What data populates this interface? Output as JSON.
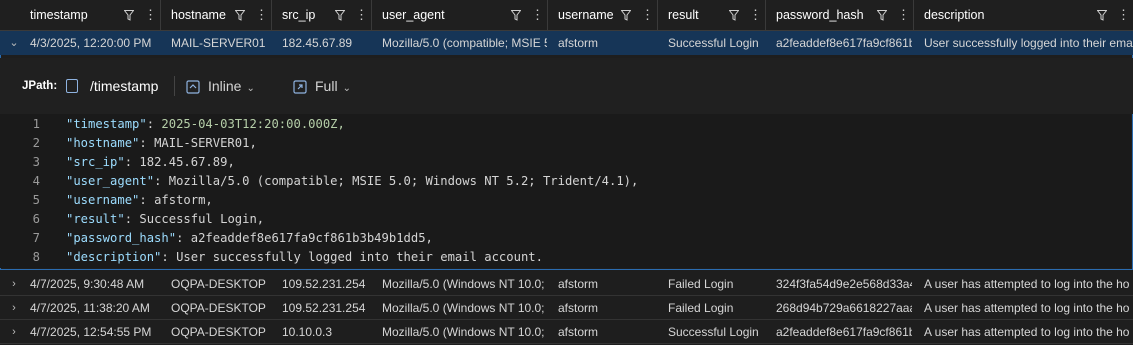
{
  "columns": [
    {
      "key": "timestamp",
      "label": "timestamp"
    },
    {
      "key": "hostname",
      "label": "hostname"
    },
    {
      "key": "src_ip",
      "label": "src_ip"
    },
    {
      "key": "user_agent",
      "label": "user_agent"
    },
    {
      "key": "username",
      "label": "username"
    },
    {
      "key": "result",
      "label": "result"
    },
    {
      "key": "password_hash",
      "label": "password_hash"
    },
    {
      "key": "description",
      "label": "description"
    }
  ],
  "expanded_row": {
    "timestamp": "4/3/2025, 12:20:00 PM",
    "hostname": "MAIL-SERVER01",
    "src_ip": "182.45.67.89",
    "user_agent": "Mozilla/5.0 (compatible; MSIE 5",
    "username": "afstorm",
    "result": "Successful Login",
    "password_hash": "a2feaddef8e617fa9cf861b3",
    "description": "User successfully logged into their email"
  },
  "detail": {
    "jpath_label": "JPath:",
    "jpath_value": "/timestamp",
    "inline_label": "Inline",
    "full_label": "Full",
    "lines": [
      {
        "num": "1",
        "key": "\"timestamp\"",
        "value": "2025-04-03T12:20:00.000Z,"
      },
      {
        "num": "2",
        "key": "\"hostname\"",
        "value": "MAIL-SERVER01,"
      },
      {
        "num": "3",
        "key": "\"src_ip\"",
        "value": "182.45.67.89,"
      },
      {
        "num": "4",
        "key": "\"user_agent\"",
        "value": "Mozilla/5.0 (compatible; MSIE 5.0; Windows NT 5.2; Trident/4.1),"
      },
      {
        "num": "5",
        "key": "\"username\"",
        "value": "afstorm,"
      },
      {
        "num": "6",
        "key": "\"result\"",
        "value": "Successful Login,"
      },
      {
        "num": "7",
        "key": "\"password_hash\"",
        "value": "a2feaddef8e617fa9cf861b3b49b1dd5,"
      },
      {
        "num": "8",
        "key": "\"description\"",
        "value": "User successfully logged into their email account."
      }
    ]
  },
  "rows": [
    {
      "timestamp": "4/7/2025, 9:30:48 AM",
      "hostname": "OQPA-DESKTOP",
      "src_ip": "109.52.231.254",
      "user_agent": "Mozilla/5.0 (Windows NT 10.0; r",
      "username": "afstorm",
      "result": "Failed Login",
      "password_hash": "324f3fa54d9e2e568d33a4",
      "description": "A user has attempted to log into the ho"
    },
    {
      "timestamp": "4/7/2025, 11:38:20 AM",
      "hostname": "OQPA-DESKTOP",
      "src_ip": "109.52.231.254",
      "user_agent": "Mozilla/5.0 (Windows NT 10.0; r",
      "username": "afstorm",
      "result": "Failed Login",
      "password_hash": "268d94b729a6618227aaa7",
      "description": "A user has attempted to log into the ho"
    },
    {
      "timestamp": "4/7/2025, 12:54:55 PM",
      "hostname": "OQPA-DESKTOP",
      "src_ip": "10.10.0.3",
      "user_agent": "Mozilla/5.0 (Windows NT 10.0; r",
      "username": "afstorm",
      "result": "Successful Login",
      "password_hash": "a2feaddef8e617fa9cf861b3",
      "description": "A user has attempted to log into the ho"
    }
  ],
  "colors": {
    "selected_row": "#163557",
    "panel_border": "#2b6cb0",
    "json_key": "#9cdcfe",
    "json_number": "#b5cea8"
  }
}
